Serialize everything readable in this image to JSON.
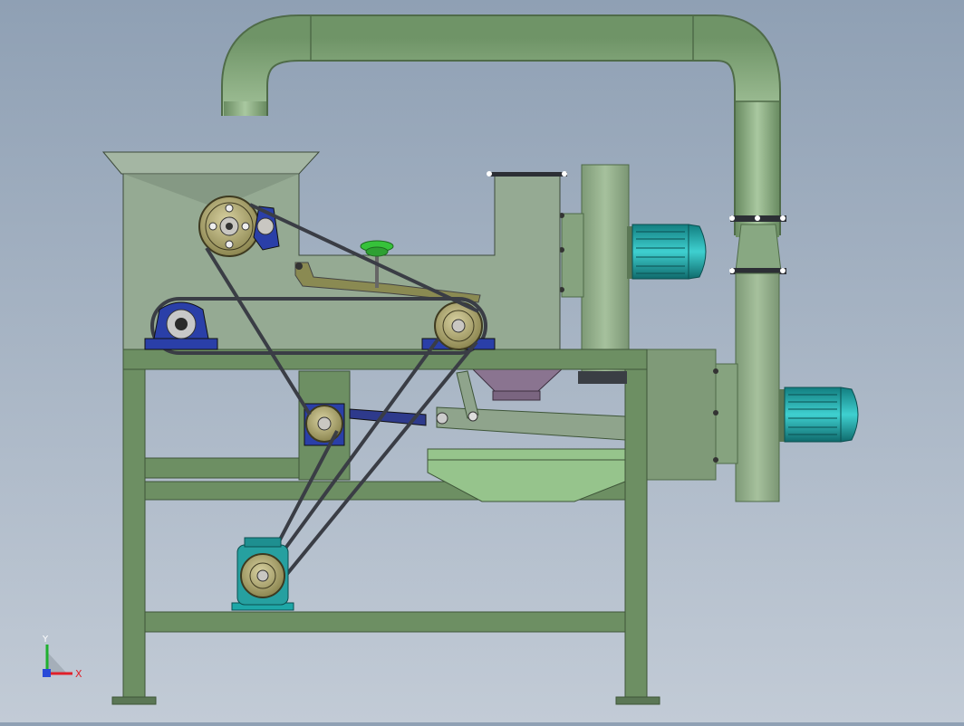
{
  "viewport": {
    "background_top": "#8fa0b4",
    "background_bottom": "#c2cbd6"
  },
  "triad": {
    "x_label": "X",
    "y_label": "Y",
    "x_color": "#e0202a",
    "y_color": "#20b030",
    "z_color": "#2a4ad8"
  },
  "colors": {
    "frame": "#6d8f63",
    "frame_dark": "#4e6a47",
    "housing": "#8da48c",
    "pipe": "#88ac80",
    "motor": "#1ea7a7",
    "pulley": "#a09a5e",
    "bearing": "#2a3fa8",
    "belt": "#3a3d45",
    "hopper_funnel": "#7e6a82",
    "valve_wheel": "#36c23a"
  },
  "icons": {
    "triad": "coordinate-triad-icon",
    "motor": "electric-motor-icon",
    "pulley": "belt-pulley-icon",
    "bearing": "pillow-block-bearing-icon",
    "valve": "hand-wheel-icon"
  }
}
